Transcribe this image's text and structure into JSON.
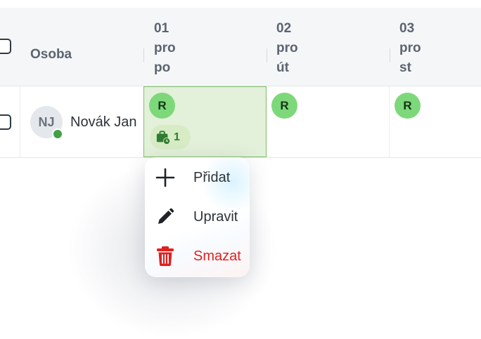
{
  "header": {
    "person_col": "Osoba",
    "days": [
      {
        "num": "01",
        "shift": "pro",
        "weekday": "po"
      },
      {
        "num": "02",
        "shift": "pro",
        "weekday": "út"
      },
      {
        "num": "03",
        "shift": "pro",
        "weekday": "st"
      }
    ]
  },
  "rows": [
    {
      "avatar_initials": "NJ",
      "name": "Novák Jan",
      "status_color": "#43a047",
      "shifts": [
        "R",
        "R",
        "R"
      ],
      "job_count": "1"
    }
  ],
  "context_menu": {
    "items": [
      {
        "label": "Přidat",
        "icon": "plus-icon"
      },
      {
        "label": "Upravit",
        "icon": "pencil-icon"
      },
      {
        "label": "Smazat",
        "icon": "trash-icon",
        "color": "#e02020"
      }
    ]
  },
  "colors": {
    "shift_chip": "#7dd87a",
    "selected_cell": "#e3f0da",
    "danger": "#e02020"
  }
}
